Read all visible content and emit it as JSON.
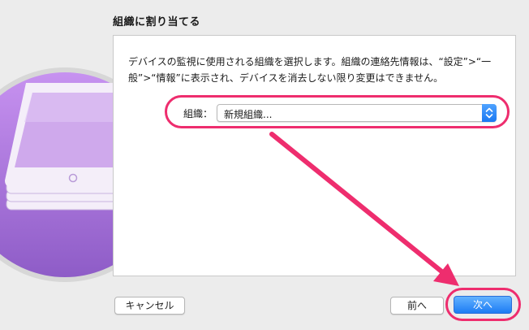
{
  "header": {
    "title": "組織に割り当てる"
  },
  "main": {
    "description": "デバイスの監視に使用される組織を選択します。組織の連絡先情報は、“設定”>“一般”>“情報”に表示され、デバイスを消去しない限り変更はできません。",
    "organization": {
      "label": "組織：",
      "selected_value": "新規組織..."
    }
  },
  "footer": {
    "cancel_label": "キャンセル",
    "back_label": "前へ",
    "next_label": "次へ"
  },
  "colors": {
    "annotation": "#ee2d6e",
    "accent": "#1c7cf4",
    "icon_purple": "#a573d6"
  },
  "icons": {
    "hero": "configurator-device-stack-icon",
    "select": "chevron-updown-icon"
  }
}
